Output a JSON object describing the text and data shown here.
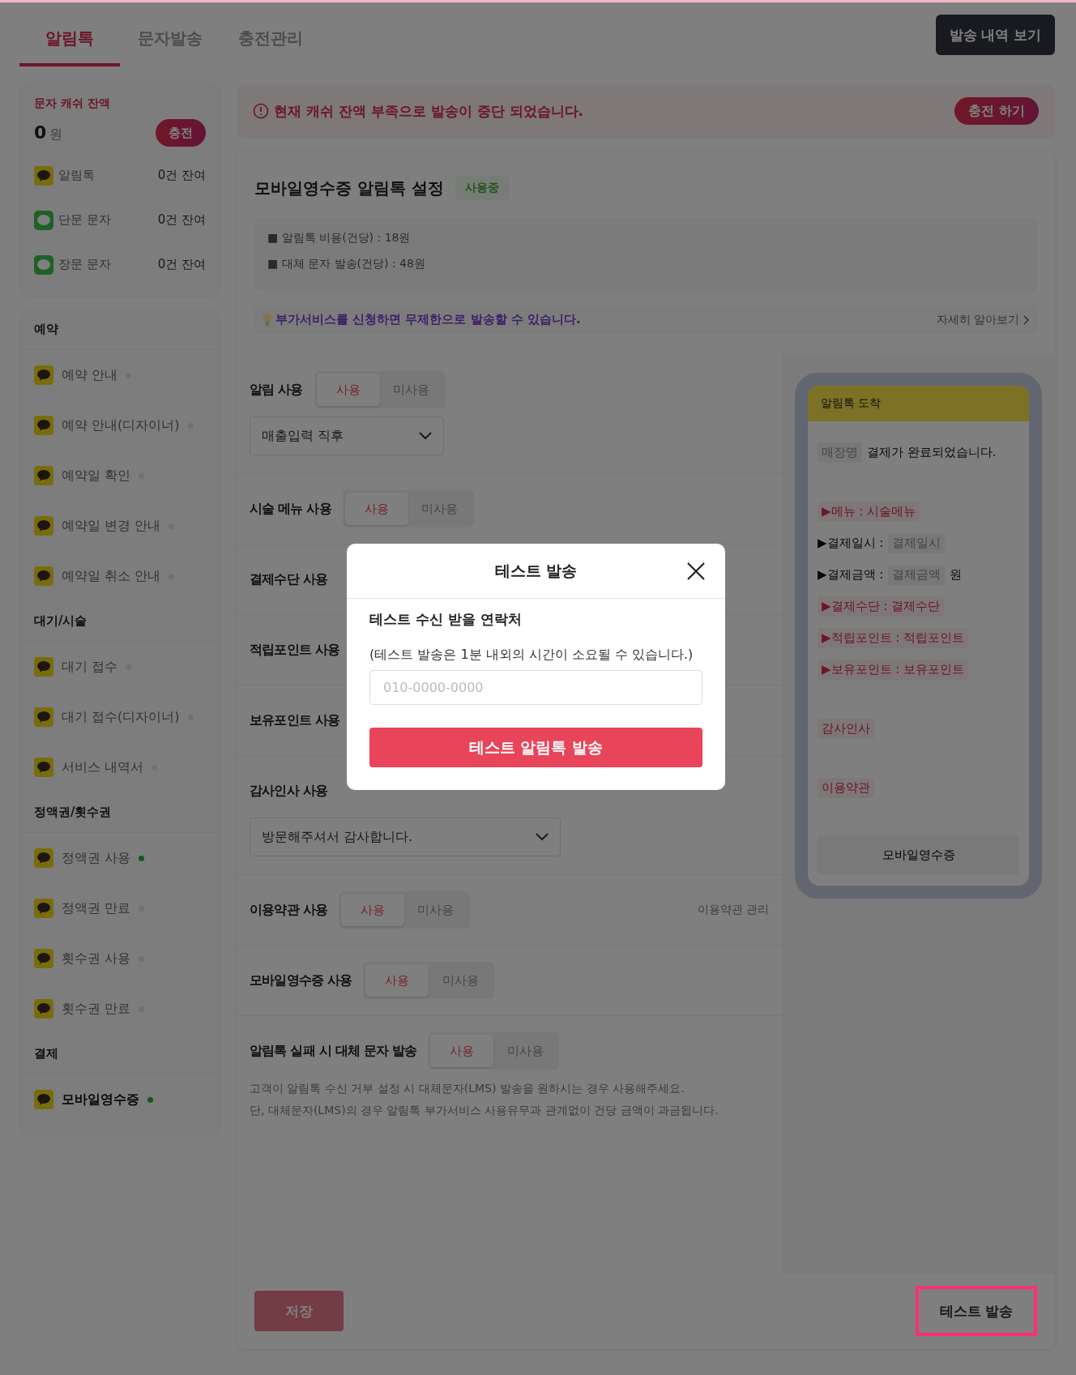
{
  "tabs": [
    {
      "label": "알림톡",
      "selected": true
    },
    {
      "label": "문자발송",
      "selected": false
    },
    {
      "label": "충전관리",
      "selected": false
    }
  ],
  "history_button": "발송 내역 보기",
  "balance": {
    "title": "문자 캐쉬 잔액",
    "amount": "0",
    "unit": "원",
    "charge_button": "충전",
    "items": [
      {
        "kind": "kakao",
        "label": "알림톡",
        "remaining": "0건 잔여"
      },
      {
        "kind": "sms",
        "label": "단문 문자",
        "remaining": "0건 잔여"
      },
      {
        "kind": "sms",
        "label": "장문 문자",
        "remaining": "0건 잔여"
      }
    ]
  },
  "menu": [
    {
      "title": "예약",
      "items": [
        {
          "label": "예약 안내",
          "on": false,
          "selected": false
        },
        {
          "label": "예약 안내(디자이너)",
          "on": false,
          "selected": false
        },
        {
          "label": "예약일 확인",
          "on": false,
          "selected": false
        },
        {
          "label": "예약일 변경 안내",
          "on": false,
          "selected": false
        },
        {
          "label": "예약일 취소 안내",
          "on": false,
          "selected": false
        }
      ]
    },
    {
      "title": "대기/시술",
      "items": [
        {
          "label": "대기 접수",
          "on": false,
          "selected": false
        },
        {
          "label": "대기 접수(디자이너)",
          "on": false,
          "selected": false
        },
        {
          "label": "서비스 내역서",
          "on": false,
          "selected": false
        }
      ]
    },
    {
      "title": "정액권/횟수권",
      "items": [
        {
          "label": "정액권 사용",
          "on": true,
          "selected": false
        },
        {
          "label": "정액권 만료",
          "on": false,
          "selected": false
        },
        {
          "label": "횟수권 사용",
          "on": false,
          "selected": false
        },
        {
          "label": "횟수권 만료",
          "on": false,
          "selected": false
        }
      ]
    },
    {
      "title": "결제",
      "items": [
        {
          "label": "모바일영수증",
          "on": true,
          "selected": true
        }
      ]
    }
  ],
  "alert": {
    "message": "현재 캐쉬 잔액 부족으로 발송이 중단 되었습니다.",
    "button": "충전 하기"
  },
  "settings": {
    "title": "모바일영수증 알림톡 설정",
    "status": "사용중",
    "fees": [
      "■ 알림톡 비용(건당) : 18원",
      "■ 대체 문자 발송(건당) : 48원"
    ],
    "tip": "부가서비스를 신청하면 무제한으로 발송할 수 있습니다.",
    "tip_link": "자세히 알아보기",
    "rows": [
      {
        "label": "알림 사용",
        "options": [
          {
            "label": "사용",
            "selected": true
          },
          {
            "label": "미사용",
            "selected": false
          }
        ],
        "select": "매출입력 직후"
      },
      {
        "label": "시술 메뉴 사용",
        "options": [
          {
            "label": "사용",
            "selected": true
          },
          {
            "label": "미사용",
            "selected": false
          }
        ]
      },
      {
        "label": "결제수단 사용"
      },
      {
        "label": "적립포인트 사용"
      },
      {
        "label": "보유포인트 사용"
      },
      {
        "label": "감사인사 사용",
        "select": "방문해주셔서 감사합니다."
      },
      {
        "label": "이용약관 사용",
        "options": [
          {
            "label": "사용",
            "selected": true
          },
          {
            "label": "미사용",
            "selected": false
          }
        ],
        "link": "이용약관 관리"
      },
      {
        "label": "모바일영수증 사용",
        "options": [
          {
            "label": "사용",
            "selected": true
          },
          {
            "label": "미사용",
            "selected": false
          }
        ]
      },
      {
        "label": "알림톡 실패 시 대체 문자 발송",
        "options": [
          {
            "label": "사용",
            "selected": true
          },
          {
            "label": "미사용",
            "selected": false
          }
        ],
        "notes": [
          "고객이 알림톡 수신 거부 설정 시 대체문자(LMS) 발송을 원하시는 경우 사용해주세요.",
          "단, 대체문자(LMS)의 경우 알림톡 부가서비스 사용유무과 관계없이 건당 금액이 과금됩니다."
        ]
      }
    ]
  },
  "preview": {
    "header": "알림톡 도착",
    "blocks": [
      [
        [
          {
            "kind": "tag",
            "text": "매장명"
          },
          {
            "kind": "plain",
            "text": "결제가 완료되었습니다."
          }
        ]
      ],
      [
        [
          {
            "kind": "variable",
            "text": "▶메뉴 : 시술메뉴"
          }
        ],
        [
          {
            "kind": "plain",
            "text": "▶결제일시 :"
          },
          {
            "kind": "tag",
            "text": "결제일시"
          }
        ],
        [
          {
            "kind": "plain",
            "text": "▶결제금액 :"
          },
          {
            "kind": "tag",
            "text": "결제금액"
          },
          {
            "kind": "plain",
            "text": "원"
          }
        ],
        [
          {
            "kind": "variable",
            "text": "▶결제수단 : 결제수단"
          }
        ],
        [
          {
            "kind": "variable",
            "text": "▶적립포인트 : 적립포인트"
          }
        ],
        [
          {
            "kind": "variable",
            "text": "▶보유포인트 : 보유포인트"
          }
        ]
      ],
      [
        [
          {
            "kind": "variable",
            "text": "감사인사"
          }
        ]
      ],
      [
        [
          {
            "kind": "variable",
            "text": "이용약관"
          }
        ]
      ]
    ],
    "button": "모바일영수증"
  },
  "save_button": {
    "label": "저장",
    "disabled": true
  },
  "test_button": {
    "label": "테스트 발송",
    "highlighted": true
  },
  "modal": {
    "title": "테스트 발송",
    "label": "테스트 수신 받을 연락처",
    "note": "(테스트 발송은 1분 내외의 시간이 소요될 수 있습니다.)",
    "placeholder": "010-0000-0000",
    "submit": "테스트 알림톡 발송"
  }
}
